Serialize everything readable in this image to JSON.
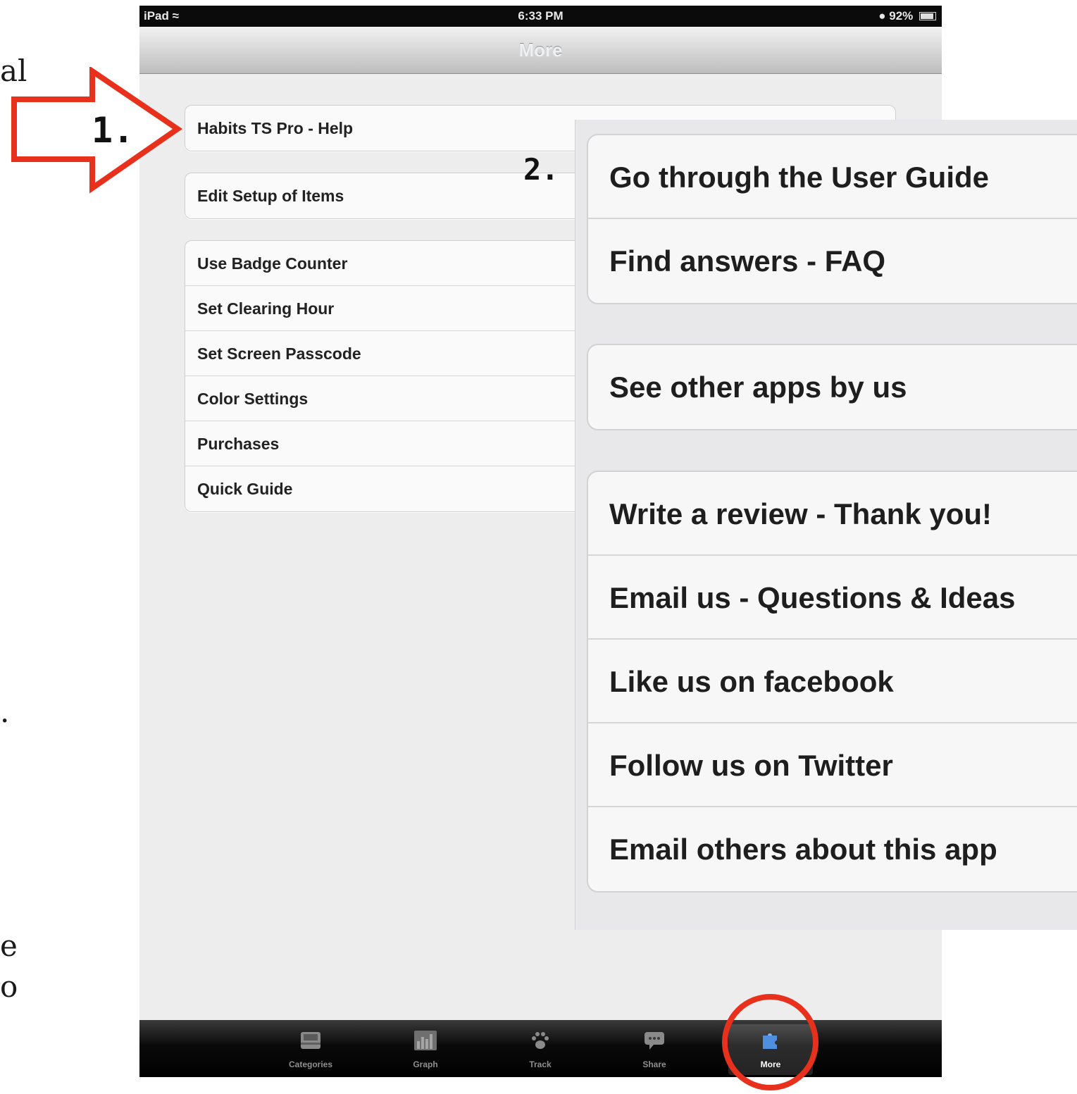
{
  "left_fragments": [
    "al",
    ".",
    "e",
    "o"
  ],
  "status_bar": {
    "carrier": "iPad",
    "time": "6:33 PM",
    "battery": "92%"
  },
  "nav": {
    "title": "More"
  },
  "groups": [
    {
      "items": [
        "Habits TS Pro - Help"
      ]
    },
    {
      "items": [
        "Edit Setup of Items"
      ]
    },
    {
      "items": [
        "Use Badge Counter",
        "Set Clearing Hour",
        "Set Screen Passcode",
        "Color Settings",
        "Purchases",
        "Quick Guide"
      ]
    }
  ],
  "tabs": [
    {
      "label": "Categories",
      "icon": "inbox-icon"
    },
    {
      "label": "Graph",
      "icon": "bar-graph-icon"
    },
    {
      "label": "Track",
      "icon": "paw-icon"
    },
    {
      "label": "Share",
      "icon": "speech-bubble-icon"
    },
    {
      "label": "More",
      "icon": "puzzle-icon",
      "active": true
    }
  ],
  "overlay_groups": [
    {
      "items": [
        "Go through the User Guide",
        "Find answers - FAQ"
      ]
    },
    {
      "items": [
        "See other apps by us"
      ]
    },
    {
      "items": [
        "Write a review - Thank you!",
        "Email us - Questions & Ideas",
        "Like us on facebook",
        "Follow us on Twitter",
        "Email others about this app"
      ]
    }
  ],
  "annotations": {
    "step1": "1.",
    "step2": "2.",
    "arrow_color": "#e8311c",
    "circle_color": "#e8311c"
  }
}
